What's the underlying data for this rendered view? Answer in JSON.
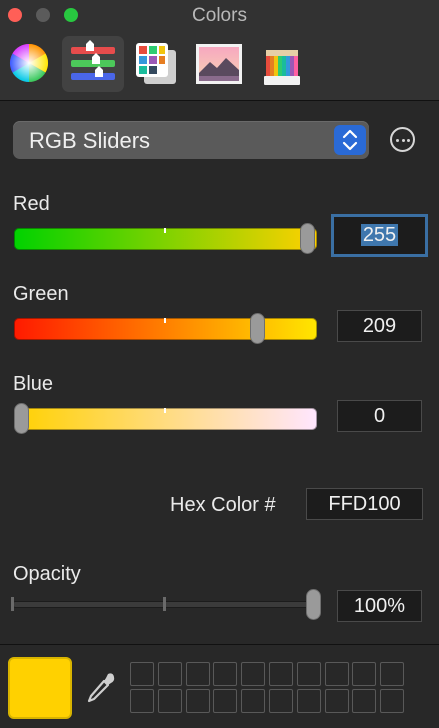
{
  "window": {
    "title": "Colors"
  },
  "toolbar": {
    "tools": [
      {
        "name": "color-wheel",
        "icon": "color-wheel-icon",
        "selected": false
      },
      {
        "name": "color-sliders",
        "icon": "sliders-icon",
        "selected": true
      },
      {
        "name": "color-palettes",
        "icon": "palettes-icon",
        "selected": false
      },
      {
        "name": "image-palettes",
        "icon": "image-icon",
        "selected": false
      },
      {
        "name": "pencils",
        "icon": "pencils-icon",
        "selected": false
      }
    ]
  },
  "mode_popup": {
    "selected": "RGB Sliders"
  },
  "red": {
    "label": "Red",
    "value": "255",
    "fraction": 1.0
  },
  "green": {
    "label": "Green",
    "value": "209",
    "fraction": 0.82
  },
  "blue": {
    "label": "Blue",
    "value": "0",
    "fraction": 0.0
  },
  "hex": {
    "label": "Hex Color #",
    "value": "FFD100"
  },
  "opacity": {
    "label": "Opacity",
    "value": "100%",
    "fraction": 1.0
  },
  "current_color": "#FFD100",
  "colors": {
    "accent": "#2A6AD6",
    "focus_ring": "#3A6FA3",
    "current": "#FFD100"
  }
}
